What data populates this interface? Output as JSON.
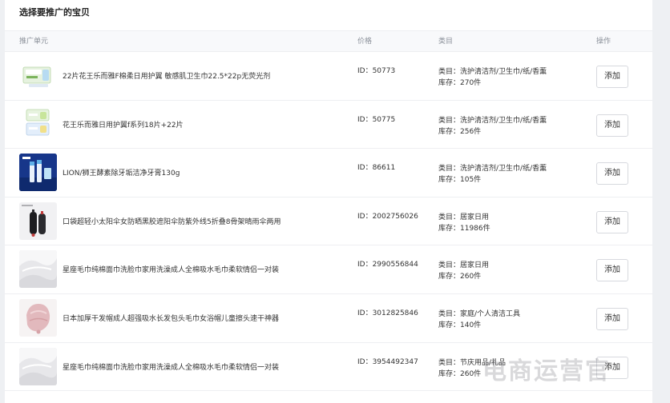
{
  "title": "选择要推广的宝贝",
  "columns": {
    "unit": "推广单元",
    "price": "价格",
    "category": "类目",
    "action": "操作"
  },
  "rows": [
    {
      "name": "22片花王乐而雅F棉柔日用护翼 敏感肌卫生巾22.5*22p无荧光剂",
      "id": "ID：50773",
      "category": "类目：洗护清洁剂/卫生巾/纸/香薰",
      "stock": "库存：270件",
      "action": "添加",
      "thumb": "sanitary-pad-package-icon"
    },
    {
      "name": "花王乐而雅日用护翼f系列18片+22片",
      "id": "ID：50775",
      "category": "类目：洗护清洁剂/卫生巾/纸/香薰",
      "stock": "库存：256件",
      "action": "添加",
      "thumb": "sanitary-pad-bundle-icon"
    },
    {
      "name": "LION/狮王酵素除牙垢洁净牙膏130g",
      "id": "ID：86611",
      "category": "类目：洗护清洁剂/卫生巾/纸/香薰",
      "stock": "库存：105件",
      "action": "添加",
      "thumb": "toothpaste-icon"
    },
    {
      "name": "口袋超轻小太阳伞女防晒黑胶遮阳伞防紫外线5折叠8骨架晴雨伞两用",
      "id": "ID：2002756026",
      "category": "类目：居家日用",
      "stock": "库存：11986件",
      "action": "添加",
      "thumb": "umbrella-icon"
    },
    {
      "name": "星座毛巾纯棉面巾洗脸巾家用洗澡成人全棉吸水毛巾柔软情侣一对装",
      "id": "ID：2990556844",
      "category": "类目：居家日用",
      "stock": "库存：260件",
      "action": "添加",
      "thumb": "towel-icon"
    },
    {
      "name": "日本加厚干发帽成人超强吸水长发包头毛巾女浴帽儿童擦头速干神器",
      "id": "ID：3012825846",
      "category": "类目：家庭/个人清洁工具",
      "stock": "库存：140件",
      "action": "添加",
      "thumb": "hair-cap-icon"
    },
    {
      "name": "星座毛巾纯棉面巾洗脸巾家用洗澡成人全棉吸水毛巾柔软情侣一对装",
      "id": "ID：3954492347",
      "category": "类目：节庆用品/礼品",
      "stock": "库存：260件",
      "action": "添加",
      "thumb": "towel-icon"
    }
  ],
  "watermark": "电商运营官"
}
